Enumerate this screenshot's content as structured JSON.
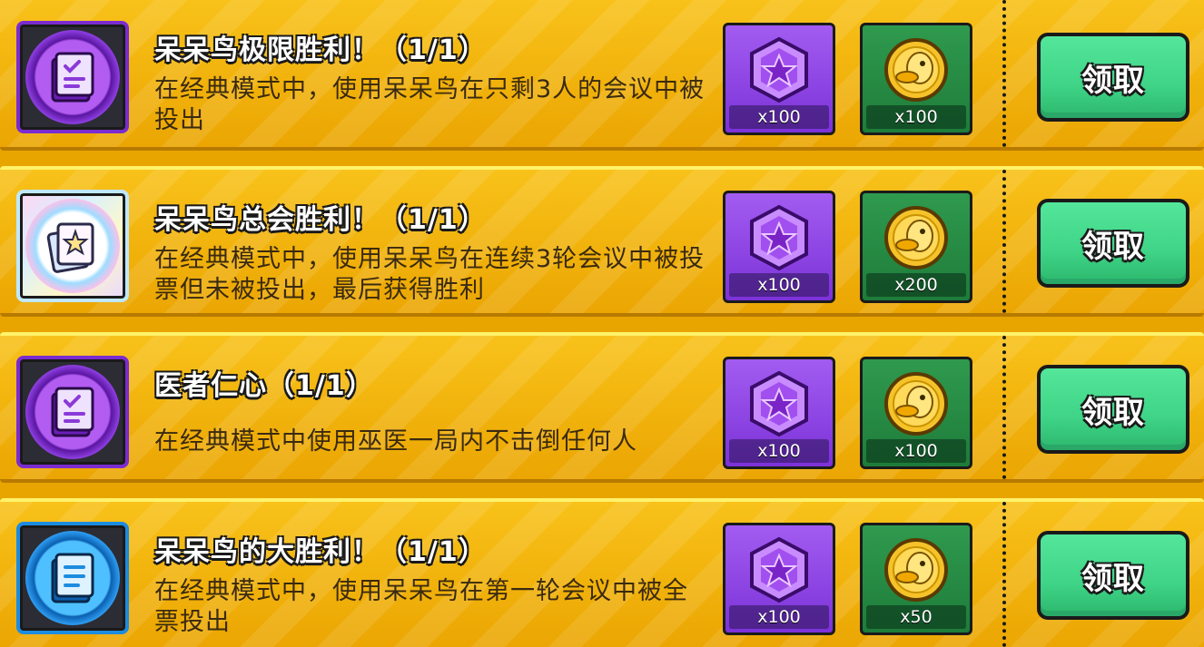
{
  "achievements": [
    {
      "title": "呆呆鸟极限胜利！（1/1）",
      "description": "在经典模式中，使用呆呆鸟在只剩3人的会议中被投出",
      "icon": "task-document-icon",
      "icon_theme": "purple",
      "rewards": [
        {
          "icon": "purple-gem-icon",
          "quantity": "x100"
        },
        {
          "icon": "duck-coin-icon",
          "quantity": "x100"
        }
      ],
      "claim_label": "领取"
    },
    {
      "title": "呆呆鸟总会胜利！（1/1）",
      "description": "在经典模式中，使用呆呆鸟在连续3轮会议中被投票但未被投出，最后获得胜利",
      "icon": "star-card-icon",
      "icon_theme": "rainbow",
      "rewards": [
        {
          "icon": "purple-gem-icon",
          "quantity": "x100"
        },
        {
          "icon": "duck-coin-icon",
          "quantity": "x200"
        }
      ],
      "claim_label": "领取"
    },
    {
      "title": "医者仁心（1/1）",
      "description": "在经典模式中使用巫医一局内不击倒任何人",
      "icon": "task-document-icon",
      "icon_theme": "purple",
      "rewards": [
        {
          "icon": "purple-gem-icon",
          "quantity": "x100"
        },
        {
          "icon": "duck-coin-icon",
          "quantity": "x100"
        }
      ],
      "claim_label": "领取"
    },
    {
      "title": "呆呆鸟的大胜利！（1/1）",
      "description": "在经典模式中，使用呆呆鸟在第一轮会议中被全票投出",
      "icon": "list-document-icon",
      "icon_theme": "blue",
      "rewards": [
        {
          "icon": "purple-gem-icon",
          "quantity": "x100"
        },
        {
          "icon": "duck-coin-icon",
          "quantity": "x50"
        }
      ],
      "claim_label": "领取"
    }
  ],
  "colors": {
    "row_gold": "#f1b20c",
    "claim_green": "#3fd487",
    "gem_purple": "#8d3ee0",
    "coin_green": "#2f9a4e"
  }
}
